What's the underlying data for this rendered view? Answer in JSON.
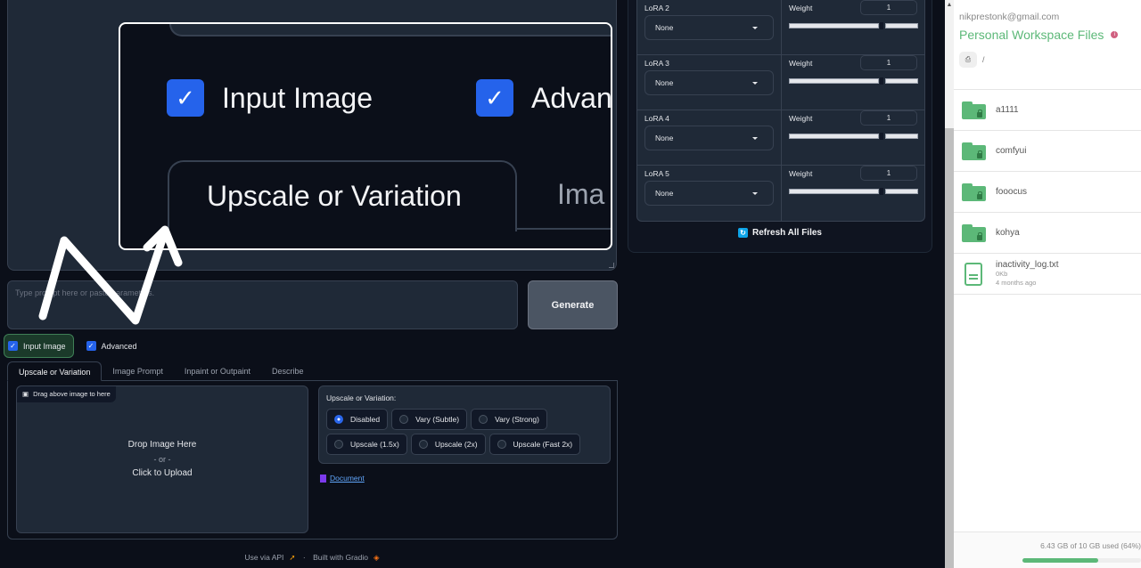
{
  "prompt": {
    "placeholder": "Type prompt here or paste parameters."
  },
  "generate_label": "Generate",
  "checkboxes": [
    {
      "label": "Input Image",
      "checked": true
    },
    {
      "label": "Advanced",
      "checked": true
    }
  ],
  "tabs": [
    {
      "label": "Upscale or Variation",
      "active": true
    },
    {
      "label": "Image Prompt",
      "active": false
    },
    {
      "label": "Inpaint or Outpaint",
      "active": false
    },
    {
      "label": "Describe",
      "active": false
    }
  ],
  "upload": {
    "drag_label": "Drag above image to here",
    "drop": "Drop Image Here",
    "or": "- or -",
    "click": "Click to Upload"
  },
  "variation": {
    "title": "Upscale or Variation:",
    "options": [
      {
        "label": "Disabled",
        "selected": true
      },
      {
        "label": "Vary (Subtle)",
        "selected": false
      },
      {
        "label": "Vary (Strong)",
        "selected": false
      },
      {
        "label": "Upscale (1.5x)",
        "selected": false
      },
      {
        "label": "Upscale (2x)",
        "selected": false
      },
      {
        "label": "Upscale (Fast 2x)",
        "selected": false
      }
    ]
  },
  "document_link": "Document",
  "footer": {
    "api": "Use via API",
    "sep": "·",
    "built": "Built with Gradio"
  },
  "zoom_overlay": {
    "input_image": "Input Image",
    "advanced": "Advan",
    "tab_active": "Upscale or Variation",
    "tab_next": "Ima"
  },
  "loras": [
    {
      "label": "LoRA 2",
      "model": "None",
      "weight_label": "Weight",
      "weight": "1",
      "weight_fraction": 0.72
    },
    {
      "label": "LoRA 3",
      "model": "None",
      "weight_label": "Weight",
      "weight": "1",
      "weight_fraction": 0.72
    },
    {
      "label": "LoRA 4",
      "model": "None",
      "weight_label": "Weight",
      "weight": "1",
      "weight_fraction": 0.72
    },
    {
      "label": "LoRA 5",
      "model": "None",
      "weight_label": "Weight",
      "weight": "1",
      "weight_fraction": 0.72
    }
  ],
  "refresh_label": "Refresh All Files",
  "workspace": {
    "email": "nikprestonk@gmail.com",
    "title": "Personal Workspace Files",
    "path": "/",
    "items": [
      {
        "name": "a1111",
        "type": "folder"
      },
      {
        "name": "comfyui",
        "type": "folder"
      },
      {
        "name": "fooocus",
        "type": "folder"
      },
      {
        "name": "kohya",
        "type": "folder"
      },
      {
        "name": "inactivity_log.txt",
        "type": "file",
        "size": "0Kb",
        "modified": "4 months ago"
      }
    ],
    "usage_text": "6.43 GB of 10 GB used (64%)",
    "usage_percent": 64
  },
  "colors": {
    "accent": "#2563eb",
    "workspace_green": "#5cb878"
  }
}
